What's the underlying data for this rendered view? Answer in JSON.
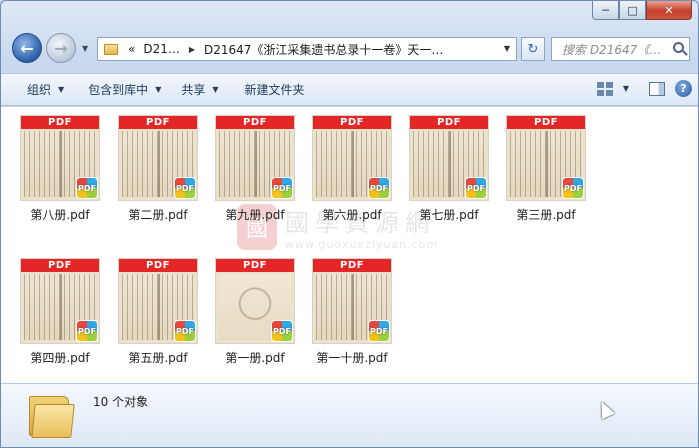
{
  "window": {
    "controls": {
      "minimize": "─",
      "maximize": "□",
      "close": "✕"
    }
  },
  "nav": {
    "address_crumbs": [
      "«",
      "D21…",
      "D21647《浙江采集遗书总录十一卷》天一…"
    ],
    "search_placeholder": "搜索 D21647《…"
  },
  "toolbar": {
    "items": [
      "组织",
      "包含到库中",
      "共享",
      "新建文件夹"
    ],
    "help": "?"
  },
  "files": [
    {
      "name": "第八册.pdf",
      "badge": "PDF"
    },
    {
      "name": "第二册.pdf",
      "badge": "PDF"
    },
    {
      "name": "第九册.pdf",
      "badge": "PDF"
    },
    {
      "name": "第六册.pdf",
      "badge": "PDF"
    },
    {
      "name": "第七册.pdf",
      "badge": "PDF"
    },
    {
      "name": "第三册.pdf",
      "badge": "PDF"
    },
    {
      "name": "第四册.pdf",
      "badge": "PDF"
    },
    {
      "name": "第五册.pdf",
      "badge": "PDF"
    },
    {
      "name": "第一册.pdf",
      "badge": "PDF"
    },
    {
      "name": "第一十册.pdf",
      "badge": "PDF"
    }
  ],
  "watermark": {
    "seal": "國",
    "chinese": "國學資源網",
    "url": "www.guoxueziyuan.com"
  },
  "details": {
    "count": "10 个对象"
  }
}
